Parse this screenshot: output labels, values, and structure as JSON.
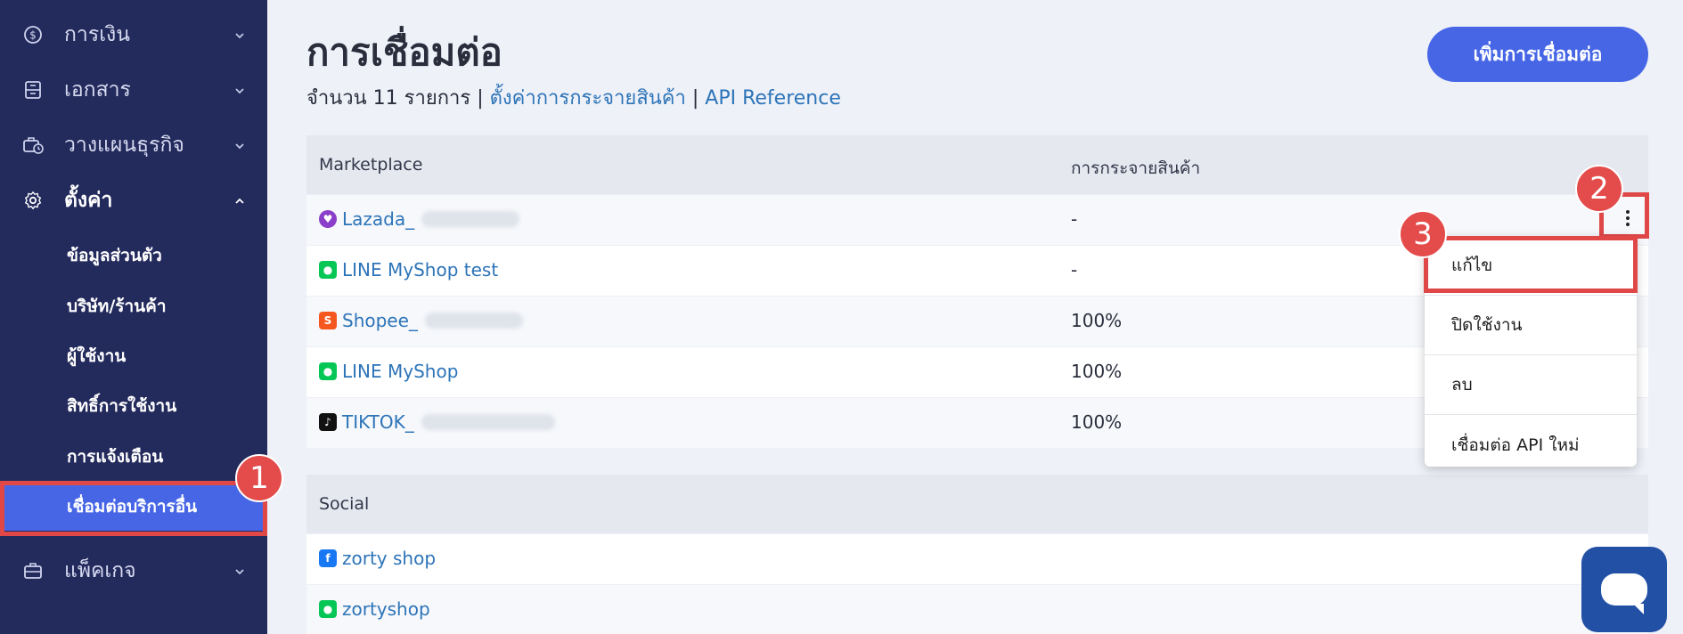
{
  "sidebar": {
    "finance": "การเงิน",
    "documents": "เอกสาร",
    "business_plan": "วางแผนธุรกิจ",
    "settings": "ตั้งค่า",
    "sub": [
      "ข้อมูลส่วนตัว",
      "บริษัท/ร้านค้า",
      "ผู้ใช้งาน",
      "สิทธิ์การใช้งาน",
      "การแจ้งเตือน",
      "เชื่อมต่อบริการอื่น"
    ],
    "package": "แพ็คเกจ"
  },
  "badges": {
    "one": "1",
    "two": "2",
    "three": "3"
  },
  "page": {
    "title": "การเชื่อมต่อ",
    "count_text": "จำนวน 11 รายการ",
    "sep": "|",
    "link_distribution": "ตั้งค่าการกระจายสินค้า",
    "link_api": "API Reference",
    "add_button": "เพิ่มการเชื่อมต่อ"
  },
  "marketplace": {
    "headers": [
      "Marketplace",
      "การกระจายสินค้า"
    ],
    "rows": [
      {
        "name": "Lazada_",
        "dist": "-"
      },
      {
        "name": "LINE MyShop test",
        "dist": "-"
      },
      {
        "name": "Shopee_",
        "dist": "100%"
      },
      {
        "name": "LINE MyShop",
        "dist": "100%"
      },
      {
        "name": "TIKTOK_",
        "dist": "100%"
      }
    ]
  },
  "social": {
    "header": "Social",
    "rows": [
      {
        "name": "zorty shop"
      },
      {
        "name": "zortyshop"
      }
    ]
  },
  "menu": {
    "items": [
      "แก้ไข",
      "ปิดใช้งาน",
      "ลบ",
      "เชื่อมต่อ API ใหม่"
    ]
  },
  "colors": {
    "sidebar_bg": "#232a5c",
    "accent": "#4766e6",
    "highlight": "#e04848",
    "link": "#2d74b8"
  }
}
